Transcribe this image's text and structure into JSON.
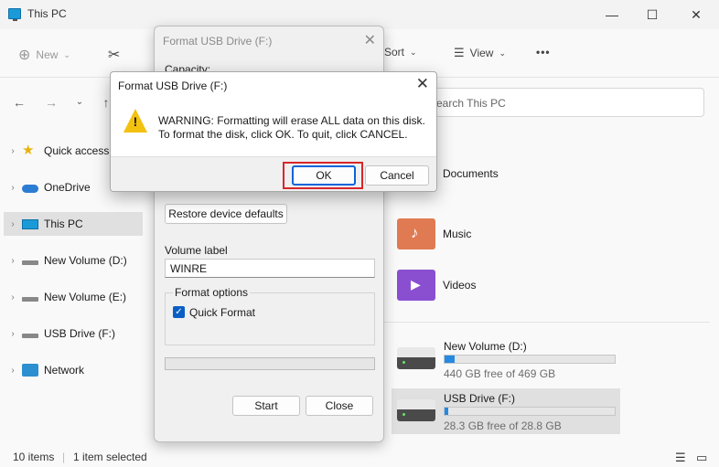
{
  "explorer": {
    "title": "This PC",
    "toolbar": {
      "new": "New",
      "sort": "Sort",
      "view": "View",
      "more": "•••"
    },
    "search_placeholder": "Search This PC",
    "sidebar": [
      {
        "label": "Quick access"
      },
      {
        "label": "OneDrive"
      },
      {
        "label": "This PC"
      },
      {
        "label": "New Volume (D:)"
      },
      {
        "label": "New Volume (E:)"
      },
      {
        "label": "USB Drive (F:)"
      },
      {
        "label": "Network"
      }
    ],
    "folders": [
      {
        "name": "Documents"
      },
      {
        "name": "Music"
      },
      {
        "name": "Videos"
      }
    ],
    "drives": [
      {
        "name": "New Volume (D:)",
        "free": "440 GB free of 469 GB",
        "used_fraction": 0.06
      },
      {
        "name": "USB Drive (F:)",
        "free": "28.3 GB free of 28.8 GB",
        "used_fraction": 0.02
      }
    ],
    "status": {
      "items": "10 items",
      "selected": "1 item selected"
    }
  },
  "format_dialog": {
    "title": "Format USB Drive (F:)",
    "capacity_label": "Capacity:",
    "restore_button": "Restore device defaults",
    "volume_label": "Volume label",
    "volume_value": "WINRE",
    "options_label": "Format options",
    "quick_format": "Quick Format",
    "start_button": "Start",
    "close_button": "Close"
  },
  "warning_dialog": {
    "title": "Format USB Drive (F:)",
    "line1": "WARNING: Formatting will erase ALL data on this disk.",
    "line2": "To format the disk, click OK. To quit, click CANCEL.",
    "ok": "OK",
    "cancel": "Cancel"
  }
}
